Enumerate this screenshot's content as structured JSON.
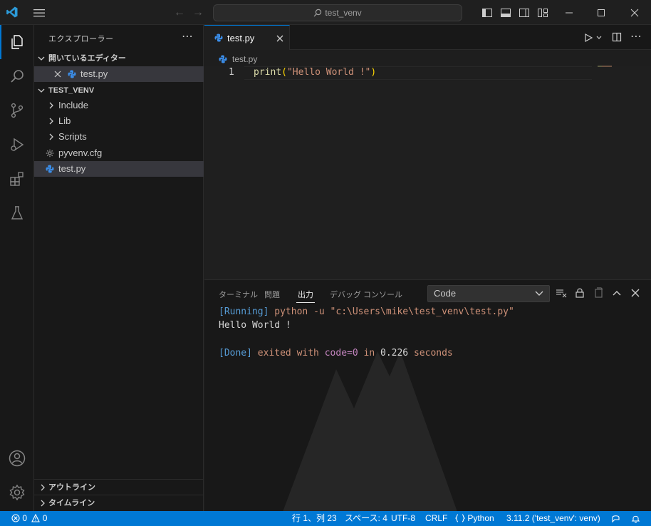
{
  "titlebar": {
    "search_text": "test_venv",
    "icons": [
      "vscode-logo-icon",
      "menu-icon",
      "back-arrow-icon",
      "forward-arrow-icon",
      "search-icon",
      "toggle-primary-sidebar-icon",
      "toggle-panel-icon",
      "toggle-secondary-sidebar-icon",
      "customize-layout-icon",
      "minimize-icon",
      "maximize-icon",
      "close-icon"
    ]
  },
  "activitybar": {
    "items": [
      "explorer-icon",
      "search-icon",
      "source-control-icon",
      "run-debug-icon",
      "extensions-icon",
      "testing-icon"
    ],
    "bottom": [
      "accounts-icon",
      "manage-gear-icon"
    ]
  },
  "sidebar": {
    "title": "エクスプローラー",
    "open_editors_label": "開いているエディター",
    "open_editor_file": "test.py",
    "folder_label": "TEST_VENV",
    "tree": [
      {
        "label": "Include",
        "type": "folder"
      },
      {
        "label": "Lib",
        "type": "folder"
      },
      {
        "label": "Scripts",
        "type": "folder"
      },
      {
        "label": "pyvenv.cfg",
        "type": "config"
      },
      {
        "label": "test.py",
        "type": "python"
      }
    ],
    "outline_label": "アウトライン",
    "timeline_label": "タイムライン"
  },
  "editor": {
    "tab_label": "test.py",
    "breadcrumb": "test.py",
    "line_number": "1",
    "code": {
      "fn": "print",
      "open": "(",
      "str": "\"Hello World !\"",
      "close": ")"
    }
  },
  "panel": {
    "tabs": [
      "ターミナル",
      "問題",
      "出力",
      "デバッグ コンソール"
    ],
    "active_tab": "出力",
    "select_value": "Code",
    "output": {
      "line1_prefix": "[Running]",
      "line1_cmd": " python -u \"c:\\Users\\mike\\test_venv\\test.py\"",
      "line2": "Hello World !",
      "line3_prefix": "[Done]",
      "line3_a": " exited with ",
      "line3_code": "code=0",
      "line3_b": " in ",
      "line3_num": "0.226",
      "line3_c": " seconds"
    }
  },
  "statusbar": {
    "errors": "0",
    "warnings": "0",
    "position": "行 1、列 23",
    "spaces": "スペース: 4",
    "encoding": "UTF-8",
    "eol": "CRLF",
    "language": "Python",
    "interpreter": "3.11.2 ('test_venv': venv)"
  },
  "colors": {
    "accent": "#0078d4",
    "python_icon": "#3b8eea"
  }
}
